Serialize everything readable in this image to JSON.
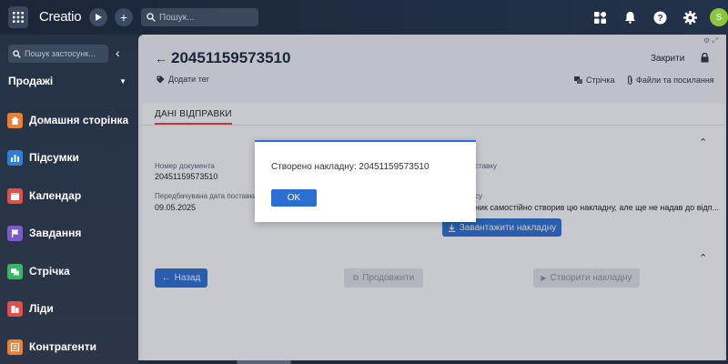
{
  "app": {
    "logo": "Creatio"
  },
  "topbar": {
    "search_placeholder": "Пошук...",
    "avatar_initial": "S"
  },
  "sidebar": {
    "search_placeholder": "Пошук застосунк...",
    "workspace": "Продажі",
    "items": [
      {
        "label": "Домашня сторінка",
        "icon": "home-icon",
        "color": "#e8803a"
      },
      {
        "label": "Підсумки",
        "icon": "bar-chart-icon",
        "color": "#2f7fd8"
      },
      {
        "label": "Календар",
        "icon": "calendar-icon",
        "color": "#e0504a"
      },
      {
        "label": "Завдання",
        "icon": "flag-icon",
        "color": "#7a5cc9"
      },
      {
        "label": "Стрічка",
        "icon": "feed-icon",
        "color": "#3db36a"
      },
      {
        "label": "Ліди",
        "icon": "leads-icon",
        "color": "#e0504a"
      },
      {
        "label": "Контрагенти",
        "icon": "accounts-icon",
        "color": "#e8803a"
      }
    ]
  },
  "record": {
    "title": "20451159573510",
    "add_tag": "Додати тег",
    "close": "Закрити",
    "feed_link": "Стрічка",
    "files_link": "Файли та посилання"
  },
  "tab": {
    "label": "ДАНІ ВІДПРАВКИ"
  },
  "fields": {
    "doc_number_label": "Номер документа",
    "doc_number_value": "20451159573510",
    "expected_date_label": "Передбачувана дата поставки",
    "expected_date_value": "09.05.2025",
    "right_label_1": "ставку",
    "right_label_2": "су",
    "right_value_2": "ник самостійно створив цю накладну, але ще не надав до відп..."
  },
  "buttons": {
    "download": "Завантажити накладну",
    "back": "Назад",
    "continue": "Продовжити",
    "create": "Створити накладну"
  },
  "modal": {
    "message": "Створено накладну: 20451159573510",
    "ok": "OK"
  }
}
